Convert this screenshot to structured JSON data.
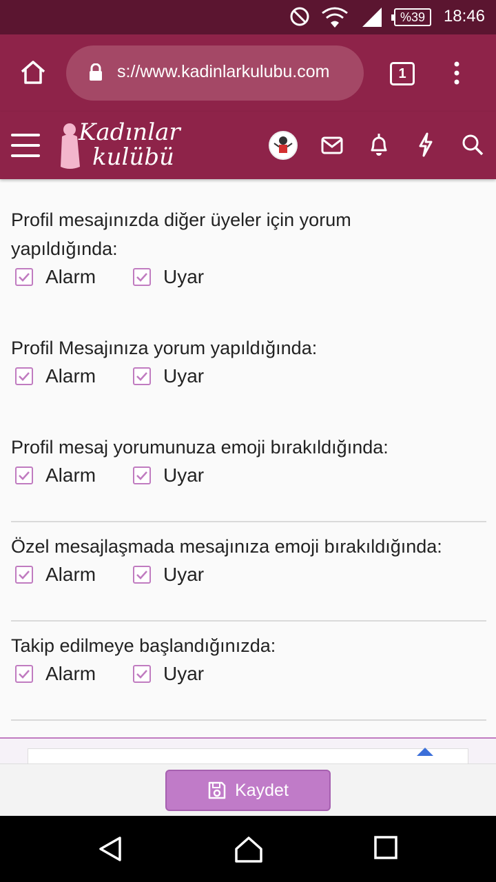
{
  "status_bar": {
    "time": "18:46",
    "battery": "%39"
  },
  "browser": {
    "url": "s://www.kadinlarkulubu.com",
    "tab_count": "1"
  },
  "site": {
    "logo_line1": "Kadınlar",
    "logo_line2": "kulübü"
  },
  "notifications": [
    {
      "label_line1": "Profil mesajınızda diğer üyeler için yorum",
      "label_line2": "yapıldığında:",
      "alarm": "Alarm",
      "uyar": "Uyar"
    },
    {
      "label_line1": "Profil Mesajınıza yorum yapıldığında:",
      "alarm": "Alarm",
      "uyar": "Uyar"
    },
    {
      "label_line1": "Profil mesaj yorumunuza emoji bırakıldığında:",
      "alarm": "Alarm",
      "uyar": "Uyar"
    },
    {
      "label_line1": "Özel mesajlaşmada mesajınıza emoji bırakıldığında:",
      "alarm": "Alarm",
      "uyar": "Uyar"
    },
    {
      "label_line1": "Takip edilmeye başlandığınızda:",
      "alarm": "Alarm",
      "uyar": "Uyar"
    }
  ],
  "save_button": {
    "label": "Kaydet"
  },
  "colors": {
    "header": "#8e2349",
    "status": "#5b1530",
    "accent": "#c07bc8",
    "checkbox": "#c07bc0"
  },
  "icons": [
    "home-icon",
    "lock-icon",
    "menu-icon",
    "overflow-menu-icon",
    "avatar",
    "mail-icon",
    "bell-icon",
    "bolt-icon",
    "search-icon",
    "checkbox-checked-icon",
    "save-icon",
    "back-icon",
    "home-nav-icon",
    "recents-icon"
  ]
}
